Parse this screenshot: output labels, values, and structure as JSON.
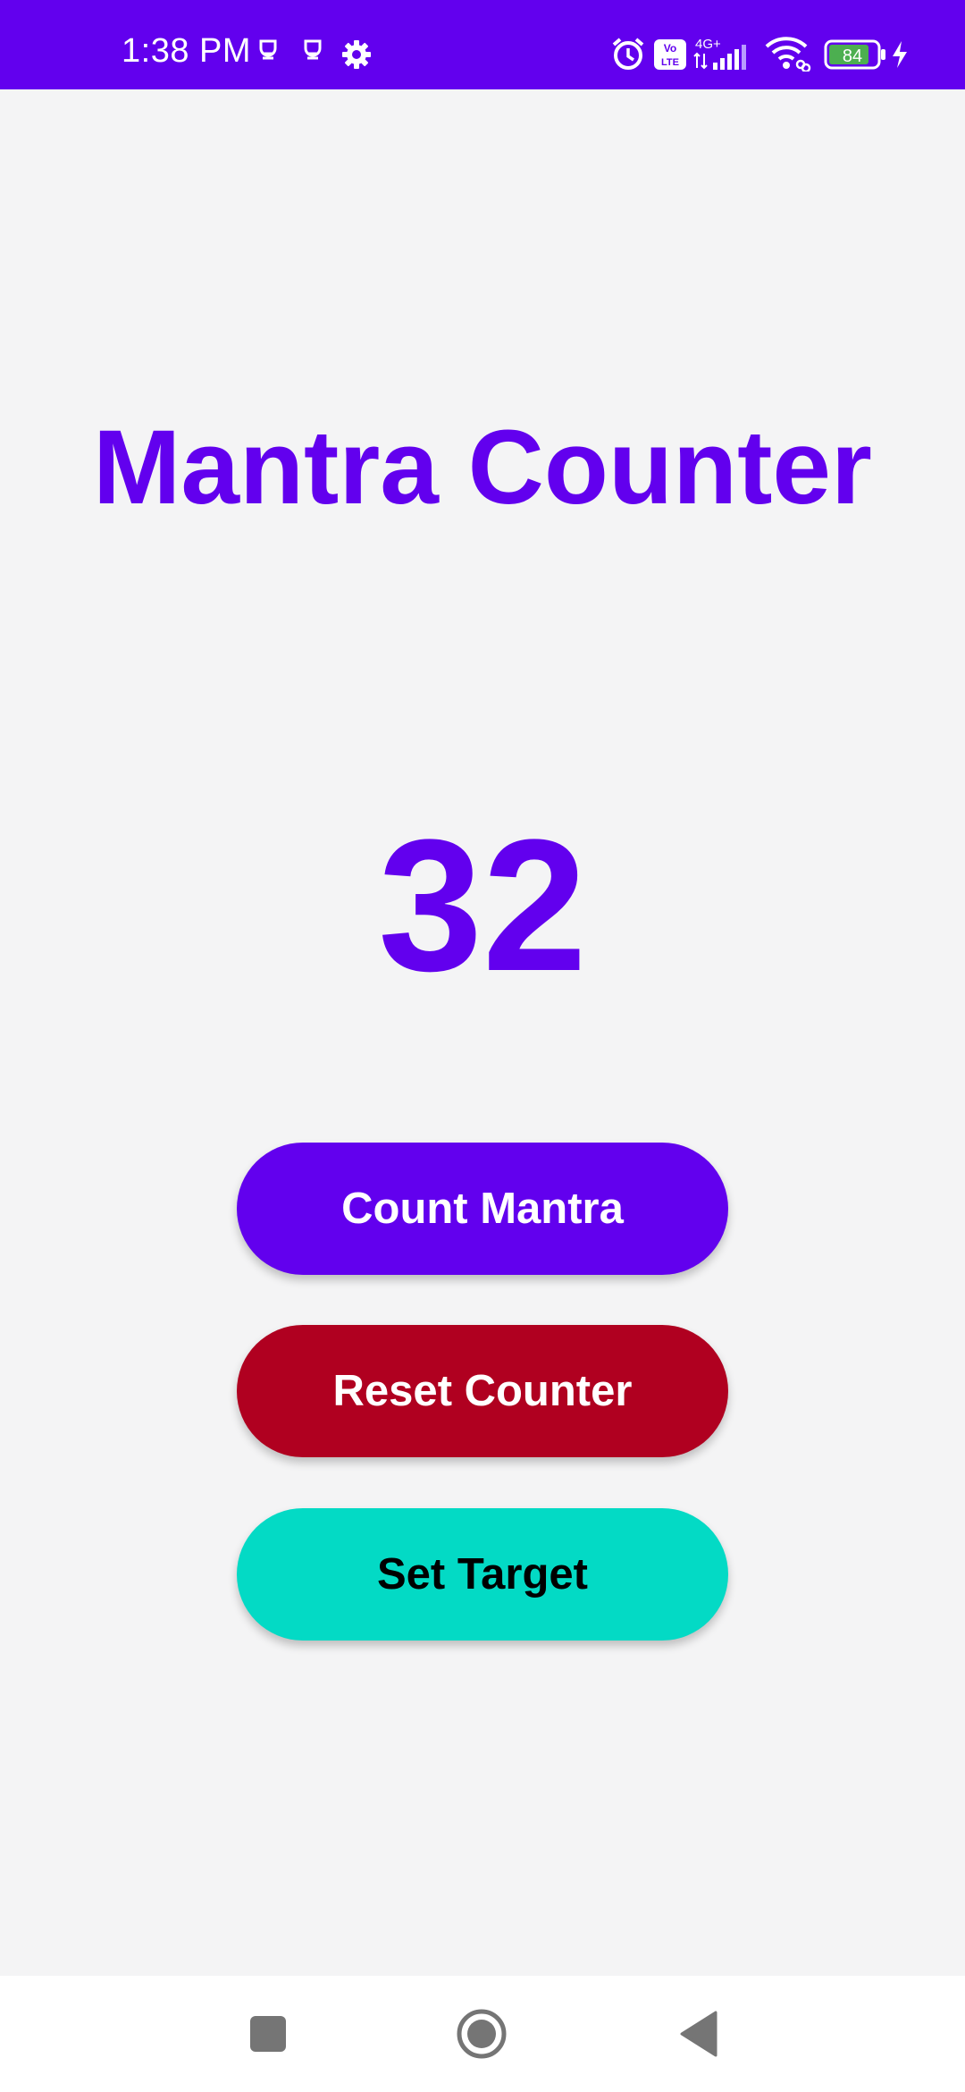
{
  "status_bar": {
    "time": "1:38 PM",
    "battery": "84",
    "network": "4G+",
    "volte": "Vo LTE",
    "icons": [
      "sim-icon",
      "sim-icon",
      "gear-icon",
      "alarm-icon",
      "volte-icon",
      "signal-icon",
      "wifi-icon",
      "battery-icon",
      "charging-icon"
    ]
  },
  "app": {
    "title": "Mantra Counter",
    "count": "32"
  },
  "buttons": {
    "count_label": "Count Mantra",
    "reset_label": "Reset Counter",
    "target_label": "Set Target"
  },
  "colors": {
    "primary": "#6200ee",
    "reset": "#b00020",
    "target": "#03dac5",
    "background": "#f4f4f5"
  },
  "nav_bar": {
    "icons": [
      "recents-icon",
      "home-icon",
      "back-icon"
    ]
  }
}
